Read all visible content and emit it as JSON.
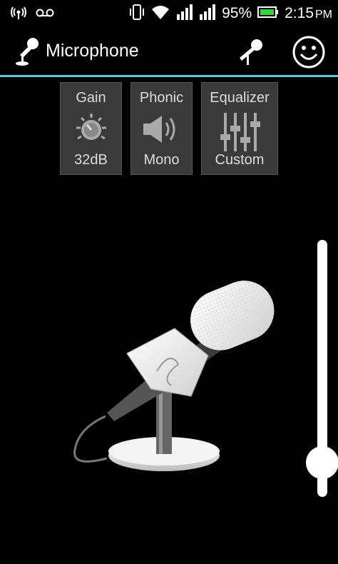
{
  "status_bar": {
    "battery": "95%",
    "time": "2:15",
    "ampm": "PM",
    "icons": [
      "wifi-signal-icon",
      "voicemail-icon",
      "vibrate-icon",
      "wifi-icon",
      "signal-icon",
      "signal-icon",
      "battery-icon"
    ]
  },
  "action_bar": {
    "title": "Microphone",
    "app_icon": "microphone-icon",
    "actions": [
      "microphone-icon",
      "smiley-icon"
    ]
  },
  "controls": [
    {
      "label": "Gain",
      "value": "32dB",
      "icon": "gain-knob-icon"
    },
    {
      "label": "Phonic",
      "value": "Mono",
      "icon": "speaker-icon"
    },
    {
      "label": "Equalizer",
      "value": "Custom",
      "icon": "equalizer-icon"
    }
  ],
  "slider": {
    "level": 0.08
  },
  "colors": {
    "accent": "#5ad0e6",
    "tile_bg": "#3a3a3a",
    "background": "#000000"
  }
}
